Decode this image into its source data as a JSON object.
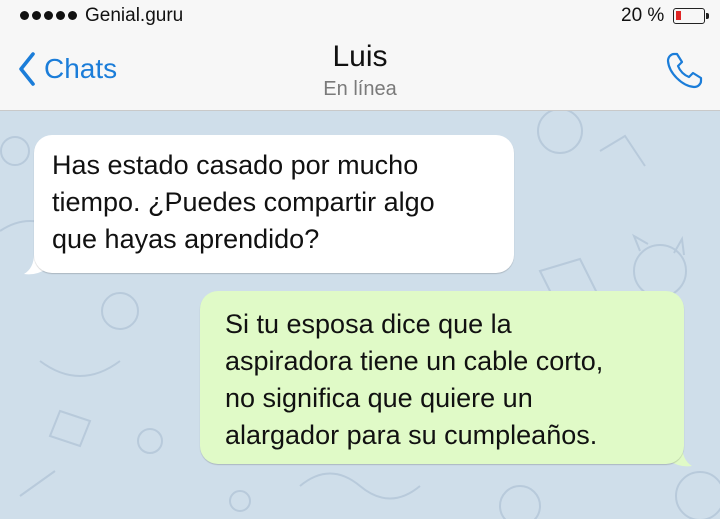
{
  "status_bar": {
    "carrier": "Genial.guru",
    "battery_percent": "20 %",
    "battery_level": 0.2,
    "battery_color": "#e02626"
  },
  "header": {
    "back_label": "Chats",
    "back_icon": "chevron-left-icon",
    "contact_name": "Luis",
    "contact_status": "En línea",
    "call_icon": "phone-icon",
    "accent_color": "#1b7dd9"
  },
  "chat": {
    "wallpaper_color": "#cfdeea",
    "messages": [
      {
        "direction": "incoming",
        "bubble_color": "#ffffff",
        "lines": [
          "Has estado casado por mucho",
          "tiempo. ¿Puedes compartir algo",
          "que hayas aprendido?"
        ]
      },
      {
        "direction": "outgoing",
        "bubble_color": "#e0fac7",
        "lines": [
          "Si tu esposa dice que la",
          "aspiradora tiene un cable corto,",
          "no significa que quiere un",
          "alargador para su cumpleaños."
        ]
      }
    ]
  }
}
